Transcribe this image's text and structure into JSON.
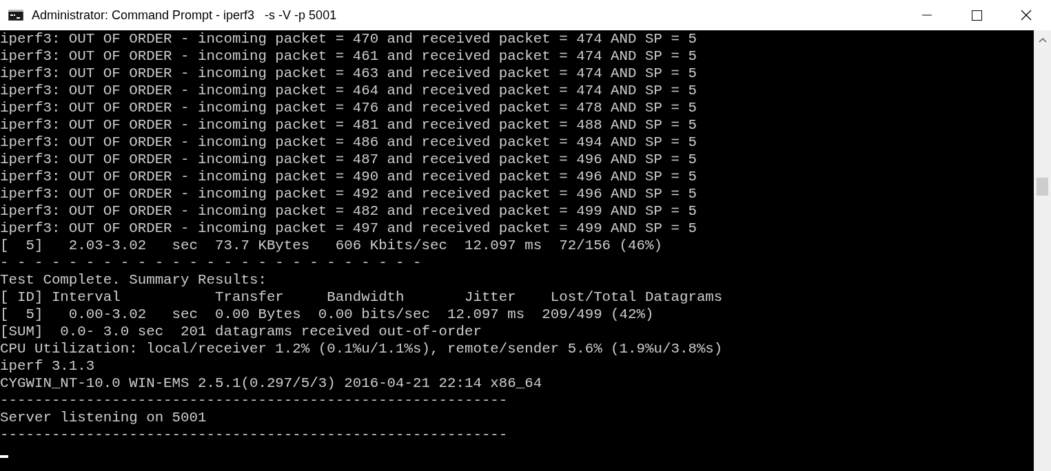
{
  "window": {
    "title": "Administrator: Command Prompt - iperf3   -s -V -p 5001"
  },
  "console": {
    "lines": [
      "iperf3: OUT OF ORDER - incoming packet = 470 and received packet = 474 AND SP = 5",
      "iperf3: OUT OF ORDER - incoming packet = 461 and received packet = 474 AND SP = 5",
      "iperf3: OUT OF ORDER - incoming packet = 463 and received packet = 474 AND SP = 5",
      "iperf3: OUT OF ORDER - incoming packet = 464 and received packet = 474 AND SP = 5",
      "iperf3: OUT OF ORDER - incoming packet = 476 and received packet = 478 AND SP = 5",
      "iperf3: OUT OF ORDER - incoming packet = 481 and received packet = 488 AND SP = 5",
      "iperf3: OUT OF ORDER - incoming packet = 486 and received packet = 494 AND SP = 5",
      "iperf3: OUT OF ORDER - incoming packet = 487 and received packet = 496 AND SP = 5",
      "iperf3: OUT OF ORDER - incoming packet = 490 and received packet = 496 AND SP = 5",
      "iperf3: OUT OF ORDER - incoming packet = 492 and received packet = 496 AND SP = 5",
      "iperf3: OUT OF ORDER - incoming packet = 482 and received packet = 499 AND SP = 5",
      "iperf3: OUT OF ORDER - incoming packet = 497 and received packet = 499 AND SP = 5",
      "[  5]   2.03-3.02   sec  73.7 KBytes   606 Kbits/sec  12.097 ms  72/156 (46%)",
      "- - - - - - - - - - - - - - - - - - - - - - - - -",
      "Test Complete. Summary Results:",
      "[ ID] Interval           Transfer     Bandwidth       Jitter    Lost/Total Datagrams",
      "[  5]   0.00-3.02   sec  0.00 Bytes  0.00 bits/sec  12.097 ms  209/499 (42%)",
      "[SUM]  0.0- 3.0 sec  201 datagrams received out-of-order",
      "CPU Utilization: local/receiver 1.2% (0.1%u/1.1%s), remote/sender 5.6% (1.9%u/3.8%s)",
      "iperf 3.1.3",
      "CYGWIN_NT-10.0 WIN-EMS 2.5.1(0.297/5/3) 2016-04-21 22:14 x86_64",
      "-----------------------------------------------------------",
      "Server listening on 5001",
      "-----------------------------------------------------------"
    ],
    "cursor": true
  }
}
